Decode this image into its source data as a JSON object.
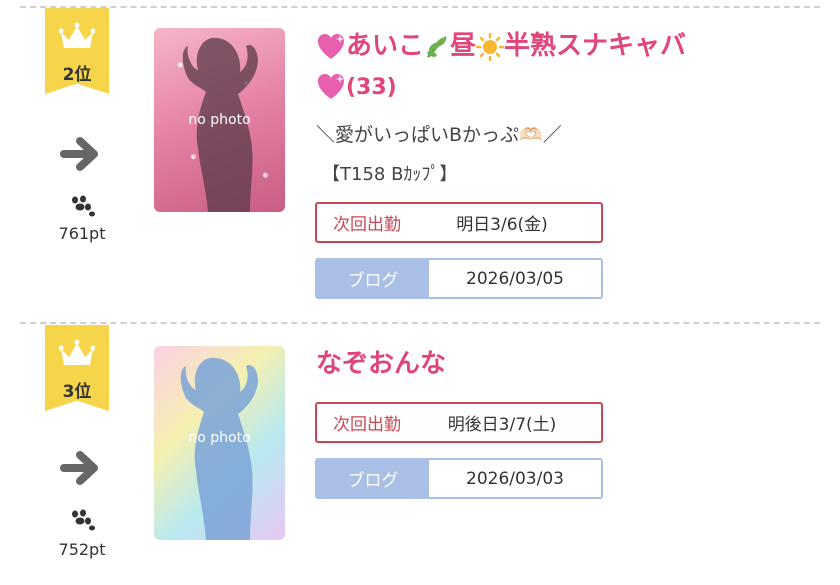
{
  "entries": [
    {
      "rank_label": "2位",
      "points": "761pt",
      "photo_label": "no photo",
      "name_prefix_icon": "sparkling-heart-icon",
      "name": "あいこ",
      "name_icon_1": "herb-icon",
      "name_mid": "昼",
      "name_icon_2": "sun-icon",
      "name_suffix": "半熟スナキャバ",
      "name_icon_3": "sparkling-heart-icon",
      "age": "(33)",
      "catch": "＼愛がいっぱいBかっぷ🫶🏻／",
      "tag": "【T158 Bｶｯﾌﾟ】",
      "next_label": "次回出勤",
      "next_value": "明日3/6(金)",
      "blog_label": "ブログ",
      "blog_value": "2026/03/05"
    },
    {
      "rank_label": "3位",
      "points": "752pt",
      "photo_label": "no photo",
      "name": "なぞおんな",
      "next_label": "次回出勤",
      "next_value": "明後日3/7(土)",
      "blog_label": "ブログ",
      "blog_value": "2026/03/03"
    }
  ],
  "colors": {
    "badge": "#f7d54a",
    "name": "#e0457b",
    "next_border": "#c94855",
    "blog_bg": "#a9bfe6"
  }
}
